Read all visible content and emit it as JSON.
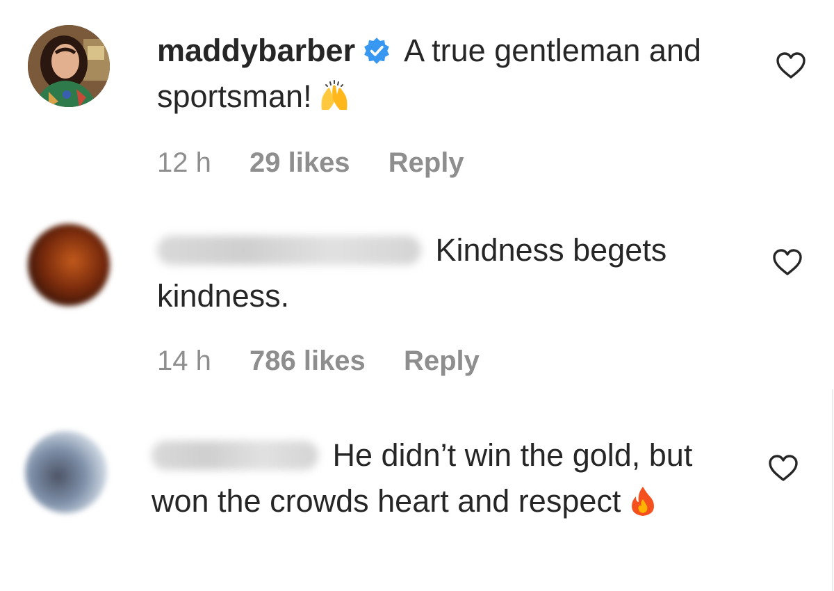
{
  "comments": [
    {
      "username": "maddybarber",
      "verified": true,
      "text": "A true gentleman and sportsman!",
      "emoji": "raising-hands-icon",
      "time": "12 h",
      "likes": "29 likes",
      "reply_label": "Reply"
    },
    {
      "username_blurred": true,
      "text": "Kindness begets kindness.",
      "time": "14 h",
      "likes": "786 likes",
      "reply_label": "Reply"
    },
    {
      "username_blurred": true,
      "text": "He didn’t win the gold, but won the crowds heart and respect",
      "emoji": "fire-icon"
    }
  ],
  "colors": {
    "text": "#262626",
    "meta": "#8e8e8e",
    "verified_badge": "#3897f0"
  }
}
